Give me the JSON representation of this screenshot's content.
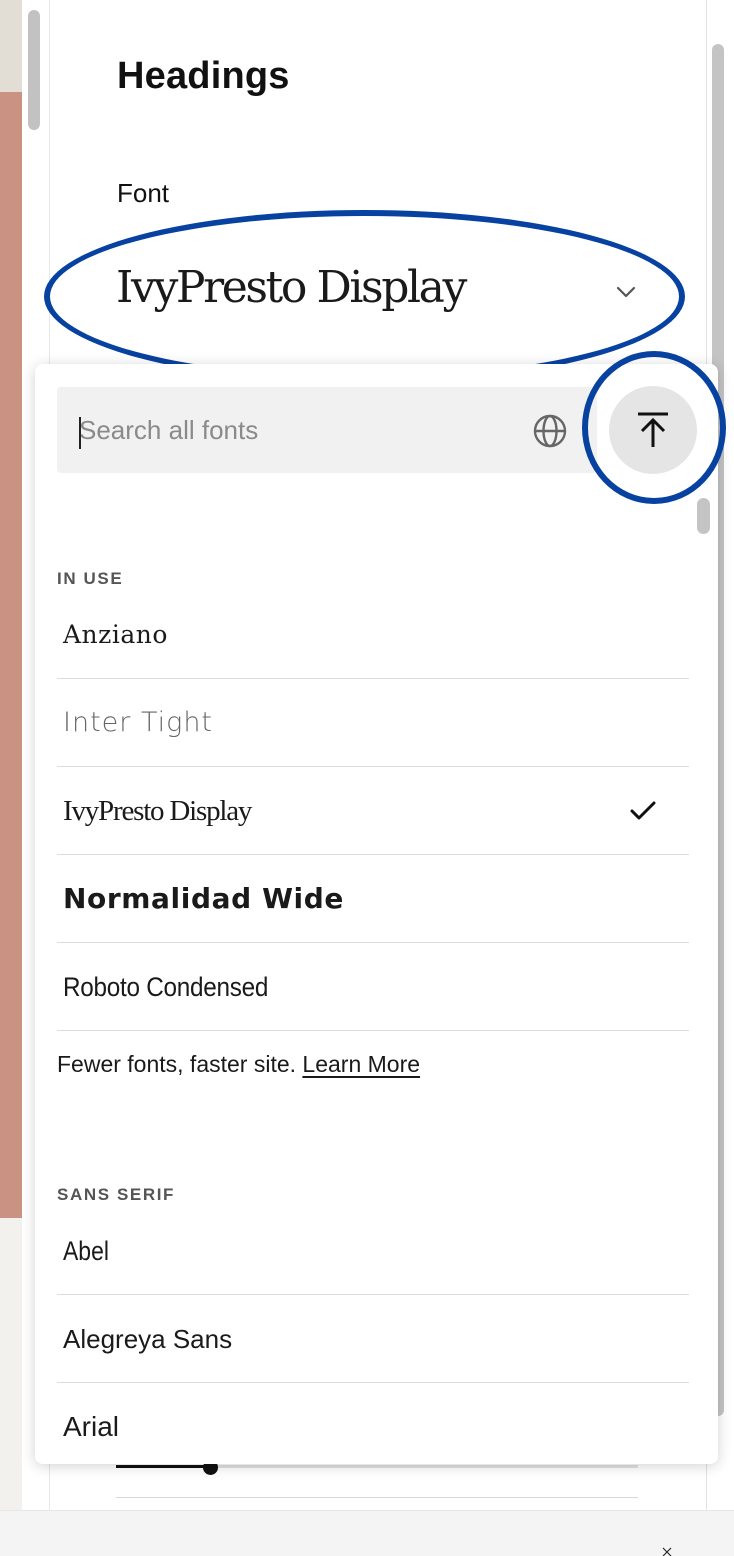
{
  "panel": {
    "heading": "Headings",
    "font_label": "Font",
    "selected_font": "IvyPresto Display"
  },
  "dropdown": {
    "search_placeholder": "Search all fonts",
    "in_use_label": "IN USE",
    "in_use_fonts": [
      {
        "name": "Anziano",
        "selected": false
      },
      {
        "name": "Inter Tight",
        "selected": false
      },
      {
        "name": "IvyPresto Display",
        "selected": true
      },
      {
        "name": "Normalidad Wide",
        "selected": false
      },
      {
        "name": "Roboto Condensed",
        "selected": false
      }
    ],
    "note_text": "Fewer fonts, faster site.",
    "note_link": "Learn More",
    "sans_serif_label": "SANS SERIF",
    "sans_serif_fonts": [
      {
        "name": "Abel"
      },
      {
        "name": "Alegreya Sans"
      },
      {
        "name": "Arial"
      }
    ]
  },
  "annotations": {
    "highlight_color": "#0842a0"
  },
  "icons": [
    "chevron-down-icon",
    "globe-icon",
    "arrow-up-to-top-icon",
    "checkmark-icon",
    "close-icon"
  ]
}
